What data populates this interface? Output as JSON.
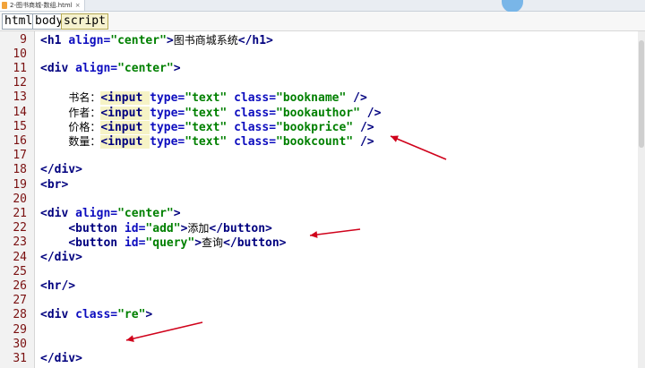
{
  "tab": {
    "title": "2-图书商城-数组.html",
    "close": "×"
  },
  "breadcrumb": [
    "html",
    "body",
    "script"
  ],
  "lines": [
    {
      "n": "9",
      "segs": [
        [
          "tg",
          "<h1 "
        ],
        [
          "at",
          "align="
        ],
        [
          "st",
          "\"center\""
        ],
        [
          "tg",
          ">"
        ],
        [
          "zh",
          "图书商城系统"
        ],
        [
          "tg",
          "</h1>"
        ]
      ]
    },
    {
      "n": "10",
      "segs": []
    },
    {
      "n": "11",
      "segs": [
        [
          "tg",
          "<div "
        ],
        [
          "at",
          "align="
        ],
        [
          "st",
          "\"center\""
        ],
        [
          "tg",
          ">"
        ]
      ]
    },
    {
      "n": "12",
      "segs": []
    },
    {
      "n": "13",
      "segs": [
        [
          "t",
          "    "
        ],
        [
          "zh",
          "书名："
        ],
        [
          "hltg",
          "<input "
        ],
        [
          "at",
          "type="
        ],
        [
          "st",
          "\"text\" "
        ],
        [
          "at",
          "class="
        ],
        [
          "st",
          "\"bookname\" "
        ],
        [
          "tg",
          "/>"
        ]
      ]
    },
    {
      "n": "14",
      "segs": [
        [
          "t",
          "    "
        ],
        [
          "zh",
          "作者："
        ],
        [
          "hltg",
          "<input "
        ],
        [
          "at",
          "type="
        ],
        [
          "st",
          "\"text\" "
        ],
        [
          "at",
          "class="
        ],
        [
          "st",
          "\"bookauthor\" "
        ],
        [
          "tg",
          "/>"
        ]
      ]
    },
    {
      "n": "15",
      "segs": [
        [
          "t",
          "    "
        ],
        [
          "zh",
          "价格："
        ],
        [
          "hltg",
          "<input "
        ],
        [
          "at",
          "type="
        ],
        [
          "st",
          "\"text\" "
        ],
        [
          "at",
          "class="
        ],
        [
          "st",
          "\"bookprice\" "
        ],
        [
          "tg",
          "/>"
        ]
      ]
    },
    {
      "n": "16",
      "segs": [
        [
          "t",
          "    "
        ],
        [
          "zh",
          "数量："
        ],
        [
          "hltg",
          "<input "
        ],
        [
          "at",
          "type="
        ],
        [
          "st",
          "\"text\" "
        ],
        [
          "at",
          "class="
        ],
        [
          "st",
          "\"bookcount\" "
        ],
        [
          "tg",
          "/>"
        ]
      ]
    },
    {
      "n": "17",
      "segs": []
    },
    {
      "n": "18",
      "segs": [
        [
          "tg",
          "</div>"
        ]
      ]
    },
    {
      "n": "19",
      "segs": [
        [
          "tg",
          "<br>"
        ]
      ]
    },
    {
      "n": "20",
      "segs": []
    },
    {
      "n": "21",
      "segs": [
        [
          "tg",
          "<div "
        ],
        [
          "at",
          "align="
        ],
        [
          "st",
          "\"center\""
        ],
        [
          "tg",
          ">"
        ]
      ]
    },
    {
      "n": "22",
      "segs": [
        [
          "t",
          "    "
        ],
        [
          "tg",
          "<button "
        ],
        [
          "at",
          "id="
        ],
        [
          "st",
          "\"add\""
        ],
        [
          "tg",
          ">"
        ],
        [
          "zh",
          "添加"
        ],
        [
          "tg",
          "</button>"
        ]
      ]
    },
    {
      "n": "23",
      "segs": [
        [
          "t",
          "    "
        ],
        [
          "tg",
          "<button "
        ],
        [
          "at",
          "id="
        ],
        [
          "st",
          "\"query\""
        ],
        [
          "tg",
          ">"
        ],
        [
          "zh",
          "查询"
        ],
        [
          "tg",
          "</button>"
        ]
      ]
    },
    {
      "n": "24",
      "segs": [
        [
          "tg",
          "</div>"
        ]
      ]
    },
    {
      "n": "25",
      "segs": []
    },
    {
      "n": "26",
      "segs": [
        [
          "tg",
          "<hr/>"
        ]
      ]
    },
    {
      "n": "27",
      "segs": []
    },
    {
      "n": "28",
      "segs": [
        [
          "tg",
          "<div "
        ],
        [
          "at",
          "class="
        ],
        [
          "st",
          "\"re\""
        ],
        [
          "tg",
          ">"
        ]
      ]
    },
    {
      "n": "29",
      "segs": []
    },
    {
      "n": "30",
      "segs": []
    },
    {
      "n": "31",
      "segs": [
        [
          "tg",
          "</div>"
        ]
      ]
    }
  ],
  "colors": {
    "tag": "#00007f",
    "attr": "#0d0dbf",
    "string": "#008000",
    "line_number": "#7a1010",
    "arrow": "#d0021b"
  },
  "icons": {
    "file": "html-file-icon",
    "close": "close-icon"
  }
}
